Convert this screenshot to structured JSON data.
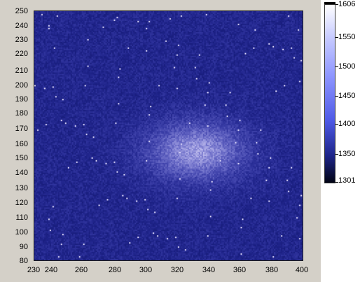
{
  "y_ticks": [
    "250",
    "240",
    "230",
    "220",
    "210",
    "200",
    "190",
    "180",
    "170",
    "160",
    "150",
    "140",
    "130",
    "120",
    "110",
    "100",
    "90",
    "80"
  ],
  "x_ticks": [
    "230",
    "240",
    "260",
    "280",
    "300",
    "320",
    "340",
    "360",
    "380",
    "400"
  ],
  "colorbar_labels": [
    "1606",
    "1550",
    "1500",
    "1450",
    "1400",
    "1350",
    "1301"
  ],
  "colors": {
    "background": "#2a37b0",
    "spot": "#8d95f0",
    "frame": "#d4d0c8"
  }
}
